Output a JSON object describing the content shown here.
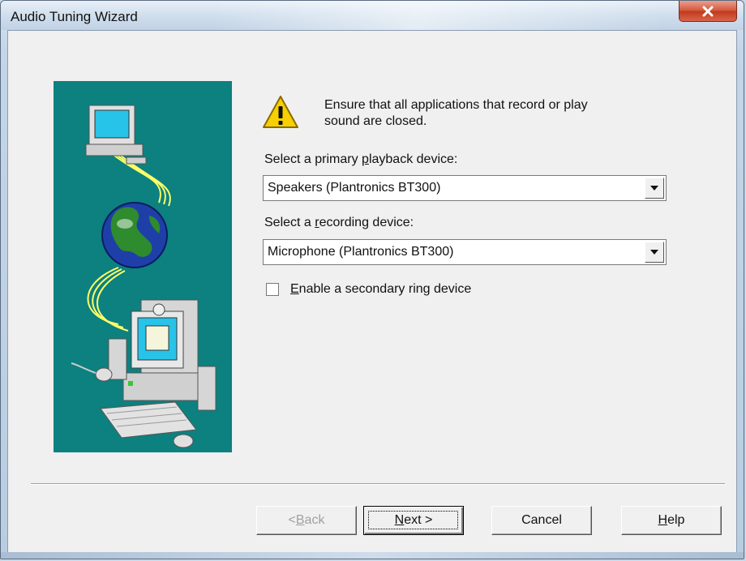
{
  "window": {
    "title": "Audio Tuning Wizard"
  },
  "warning": {
    "icon": "warning-icon",
    "text": "Ensure that all applications that record or play\nsound are closed."
  },
  "playback": {
    "label_pre": "Select a primary ",
    "label_accel": "p",
    "label_post": "layback device:",
    "value": "Speakers (Plantronics BT300)"
  },
  "recording": {
    "label_pre": "Select a ",
    "label_accel": "r",
    "label_post": "ecording device:",
    "value": "Microphone (Plantronics BT300)"
  },
  "secondary_ring": {
    "accel": "E",
    "label_post": "nable a secondary ring device",
    "checked": false
  },
  "buttons": {
    "back_pre": "< ",
    "back_accel": "B",
    "back_post": "ack",
    "next_accel": "N",
    "next_post": "ext >",
    "cancel": "Cancel",
    "help_accel": "H",
    "help_post": "elp"
  },
  "colors": {
    "illustration_bg": "#0d8080",
    "close_button": "#c8452a",
    "disabled_text": "#a0a0a0"
  }
}
